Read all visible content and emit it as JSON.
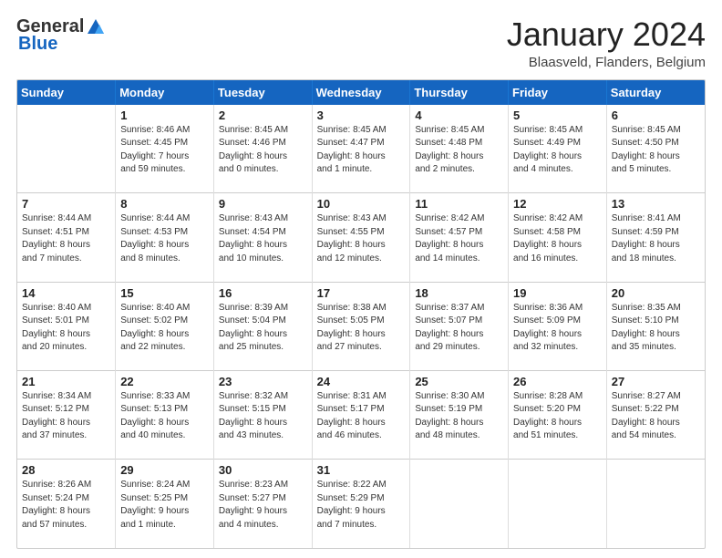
{
  "logo": {
    "general": "General",
    "blue": "Blue"
  },
  "header": {
    "month": "January 2024",
    "location": "Blaasveld, Flanders, Belgium"
  },
  "days_of_week": [
    "Sunday",
    "Monday",
    "Tuesday",
    "Wednesday",
    "Thursday",
    "Friday",
    "Saturday"
  ],
  "weeks": [
    [
      {
        "day": "",
        "info": ""
      },
      {
        "day": "1",
        "info": "Sunrise: 8:46 AM\nSunset: 4:45 PM\nDaylight: 7 hours\nand 59 minutes."
      },
      {
        "day": "2",
        "info": "Sunrise: 8:45 AM\nSunset: 4:46 PM\nDaylight: 8 hours\nand 0 minutes."
      },
      {
        "day": "3",
        "info": "Sunrise: 8:45 AM\nSunset: 4:47 PM\nDaylight: 8 hours\nand 1 minute."
      },
      {
        "day": "4",
        "info": "Sunrise: 8:45 AM\nSunset: 4:48 PM\nDaylight: 8 hours\nand 2 minutes."
      },
      {
        "day": "5",
        "info": "Sunrise: 8:45 AM\nSunset: 4:49 PM\nDaylight: 8 hours\nand 4 minutes."
      },
      {
        "day": "6",
        "info": "Sunrise: 8:45 AM\nSunset: 4:50 PM\nDaylight: 8 hours\nand 5 minutes."
      }
    ],
    [
      {
        "day": "7",
        "info": "Sunrise: 8:44 AM\nSunset: 4:51 PM\nDaylight: 8 hours\nand 7 minutes."
      },
      {
        "day": "8",
        "info": "Sunrise: 8:44 AM\nSunset: 4:53 PM\nDaylight: 8 hours\nand 8 minutes."
      },
      {
        "day": "9",
        "info": "Sunrise: 8:43 AM\nSunset: 4:54 PM\nDaylight: 8 hours\nand 10 minutes."
      },
      {
        "day": "10",
        "info": "Sunrise: 8:43 AM\nSunset: 4:55 PM\nDaylight: 8 hours\nand 12 minutes."
      },
      {
        "day": "11",
        "info": "Sunrise: 8:42 AM\nSunset: 4:57 PM\nDaylight: 8 hours\nand 14 minutes."
      },
      {
        "day": "12",
        "info": "Sunrise: 8:42 AM\nSunset: 4:58 PM\nDaylight: 8 hours\nand 16 minutes."
      },
      {
        "day": "13",
        "info": "Sunrise: 8:41 AM\nSunset: 4:59 PM\nDaylight: 8 hours\nand 18 minutes."
      }
    ],
    [
      {
        "day": "14",
        "info": "Sunrise: 8:40 AM\nSunset: 5:01 PM\nDaylight: 8 hours\nand 20 minutes."
      },
      {
        "day": "15",
        "info": "Sunrise: 8:40 AM\nSunset: 5:02 PM\nDaylight: 8 hours\nand 22 minutes."
      },
      {
        "day": "16",
        "info": "Sunrise: 8:39 AM\nSunset: 5:04 PM\nDaylight: 8 hours\nand 25 minutes."
      },
      {
        "day": "17",
        "info": "Sunrise: 8:38 AM\nSunset: 5:05 PM\nDaylight: 8 hours\nand 27 minutes."
      },
      {
        "day": "18",
        "info": "Sunrise: 8:37 AM\nSunset: 5:07 PM\nDaylight: 8 hours\nand 29 minutes."
      },
      {
        "day": "19",
        "info": "Sunrise: 8:36 AM\nSunset: 5:09 PM\nDaylight: 8 hours\nand 32 minutes."
      },
      {
        "day": "20",
        "info": "Sunrise: 8:35 AM\nSunset: 5:10 PM\nDaylight: 8 hours\nand 35 minutes."
      }
    ],
    [
      {
        "day": "21",
        "info": "Sunrise: 8:34 AM\nSunset: 5:12 PM\nDaylight: 8 hours\nand 37 minutes."
      },
      {
        "day": "22",
        "info": "Sunrise: 8:33 AM\nSunset: 5:13 PM\nDaylight: 8 hours\nand 40 minutes."
      },
      {
        "day": "23",
        "info": "Sunrise: 8:32 AM\nSunset: 5:15 PM\nDaylight: 8 hours\nand 43 minutes."
      },
      {
        "day": "24",
        "info": "Sunrise: 8:31 AM\nSunset: 5:17 PM\nDaylight: 8 hours\nand 46 minutes."
      },
      {
        "day": "25",
        "info": "Sunrise: 8:30 AM\nSunset: 5:19 PM\nDaylight: 8 hours\nand 48 minutes."
      },
      {
        "day": "26",
        "info": "Sunrise: 8:28 AM\nSunset: 5:20 PM\nDaylight: 8 hours\nand 51 minutes."
      },
      {
        "day": "27",
        "info": "Sunrise: 8:27 AM\nSunset: 5:22 PM\nDaylight: 8 hours\nand 54 minutes."
      }
    ],
    [
      {
        "day": "28",
        "info": "Sunrise: 8:26 AM\nSunset: 5:24 PM\nDaylight: 8 hours\nand 57 minutes."
      },
      {
        "day": "29",
        "info": "Sunrise: 8:24 AM\nSunset: 5:25 PM\nDaylight: 9 hours\nand 1 minute."
      },
      {
        "day": "30",
        "info": "Sunrise: 8:23 AM\nSunset: 5:27 PM\nDaylight: 9 hours\nand 4 minutes."
      },
      {
        "day": "31",
        "info": "Sunrise: 8:22 AM\nSunset: 5:29 PM\nDaylight: 9 hours\nand 7 minutes."
      },
      {
        "day": "",
        "info": ""
      },
      {
        "day": "",
        "info": ""
      },
      {
        "day": "",
        "info": ""
      }
    ]
  ]
}
